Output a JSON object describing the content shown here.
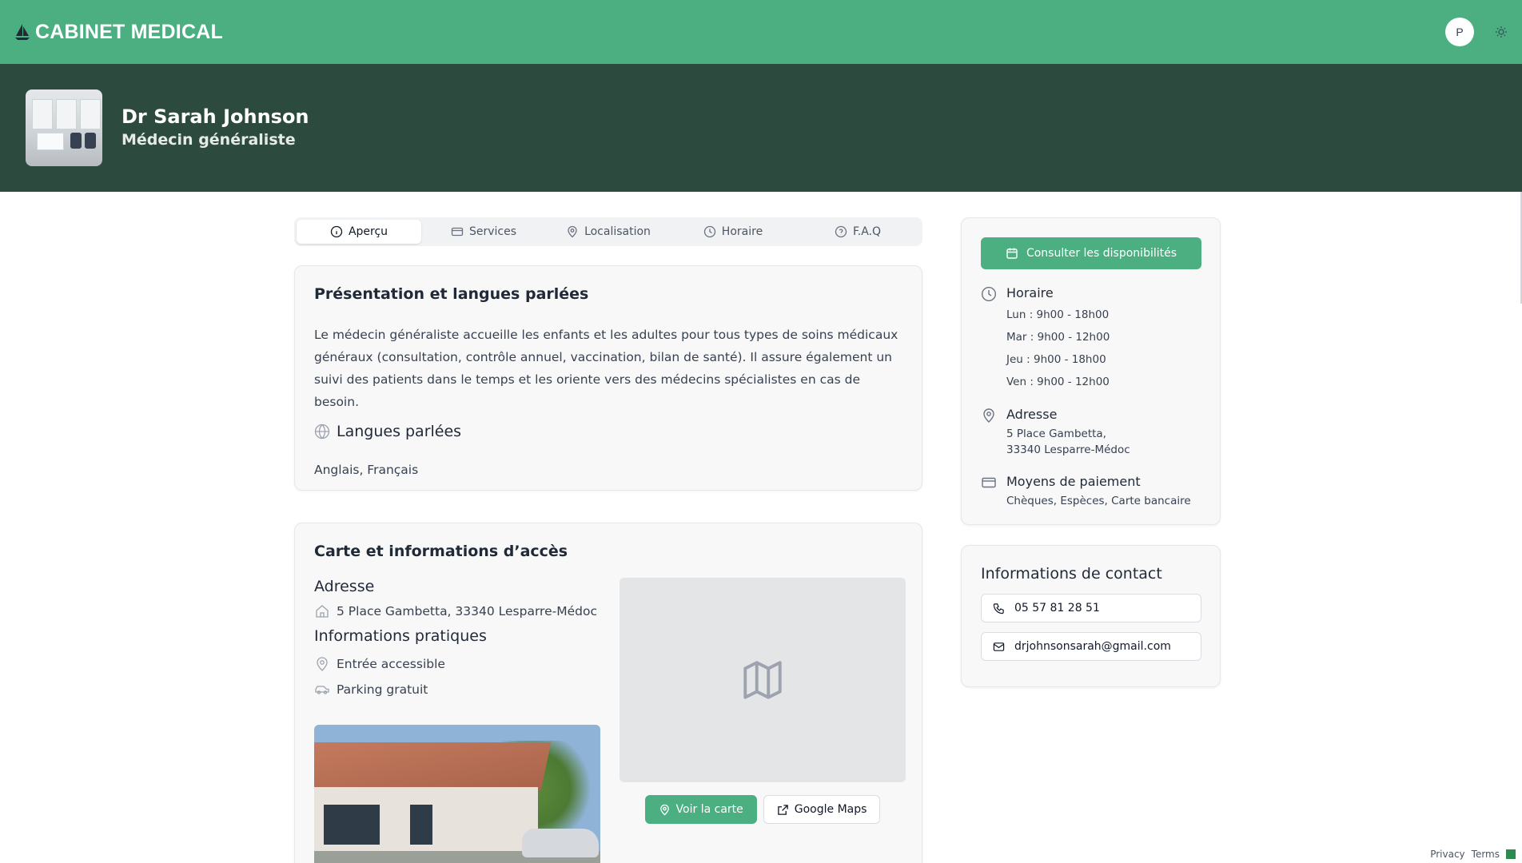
{
  "header": {
    "brand": "CABINET MEDICAL",
    "avatar_initial": "P",
    "brand_icon": "sailboat-icon",
    "theme_icon": "sun-icon"
  },
  "hero": {
    "name": "Dr Sarah Johnson",
    "specialty": "Médecin généraliste"
  },
  "tabs": [
    {
      "label": "Aperçu",
      "icon": "info-icon",
      "active": true
    },
    {
      "label": "Services",
      "icon": "credit-card-icon",
      "active": false
    },
    {
      "label": "Localisation",
      "icon": "map-pin-icon",
      "active": false
    },
    {
      "label": "Horaire",
      "icon": "clock-icon",
      "active": false
    },
    {
      "label": "F.A.Q",
      "icon": "help-circle-icon",
      "active": false
    }
  ],
  "presentation": {
    "title": "Présentation et langues parlées",
    "text": "Le médecin généraliste accueille les enfants et les adultes pour tous types de soins médicaux généraux (consultation, contrôle annuel, vaccination, bilan de santé). Il assure également un suivi des patients dans le temps et les oriente vers des médecins spécialistes en cas de besoin.",
    "languages_title": "Langues parlées",
    "languages": "Anglais, Français"
  },
  "access": {
    "title": "Carte et informations d’accès",
    "address_title": "Adresse",
    "address": "5 Place Gambetta, 33340 Lesparre-Médoc",
    "practical_title": "Informations pratiques",
    "practical": [
      "Entrée accessible",
      "Parking gratuit"
    ],
    "view_map_label": "Voir la carte",
    "google_maps_label": "Google Maps"
  },
  "sidebar": {
    "availability_label": "Consulter les disponibilités",
    "hours_title": "Horaire",
    "hours": [
      "Lun : 9h00 - 18h00",
      "Mar : 9h00 - 12h00",
      "Jeu : 9h00 - 18h00",
      "Ven : 9h00 - 12h00"
    ],
    "address_title": "Adresse",
    "address_line1": "5 Place Gambetta,",
    "address_line2": "33340 Lesparre-Médoc",
    "payment_title": "Moyens de paiement",
    "payment": "Chèques, Espèces, Carte bancaire"
  },
  "contact": {
    "title": "Informations de contact",
    "phone": "05 57 81 28 51",
    "email": "drjohnsonsarah@gmail.com"
  },
  "footer": {
    "privacy": "Privacy",
    "terms": "Terms"
  },
  "colors": {
    "primary": "#4caf82",
    "hero_bg": "#2d4a3e"
  }
}
